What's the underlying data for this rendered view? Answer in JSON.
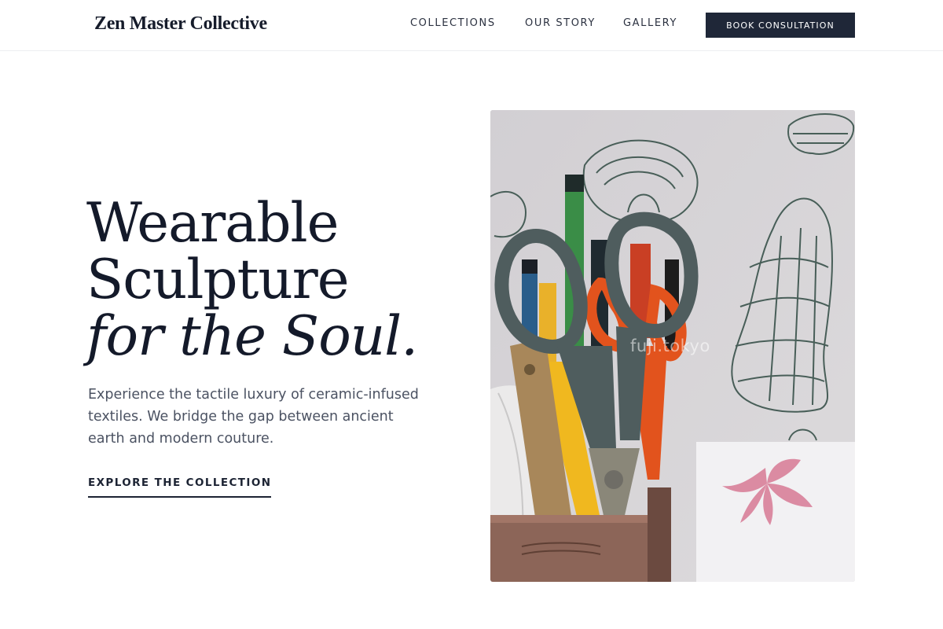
{
  "header": {
    "logo": "Zen Master Collective",
    "nav": [
      {
        "label": "COLLECTIONS"
      },
      {
        "label": "OUR STORY"
      },
      {
        "label": "GALLERY"
      }
    ],
    "cta_label": "BOOK CONSULTATION"
  },
  "hero": {
    "title_line1": "Wearable",
    "title_line2": "Sculpture",
    "title_line3": "for the Soul.",
    "description": "Experience the tactile luxury of ceramic-infused textiles. We bridge the gap between ancient earth and modern couture.",
    "cta_label": "EXPLORE THE COLLECTION",
    "image": {
      "watermark": "fuji.tokyo",
      "depicts": "pen-holder-with-scissors-photo"
    }
  },
  "colors": {
    "primary": "#1f2738",
    "text": "#141a2a",
    "muted_text": "#4b5262",
    "border": "#eceef1",
    "scissor_handle": "#4f5d5e",
    "scissor_orange": "#e2531d",
    "background": "#ffffff"
  }
}
